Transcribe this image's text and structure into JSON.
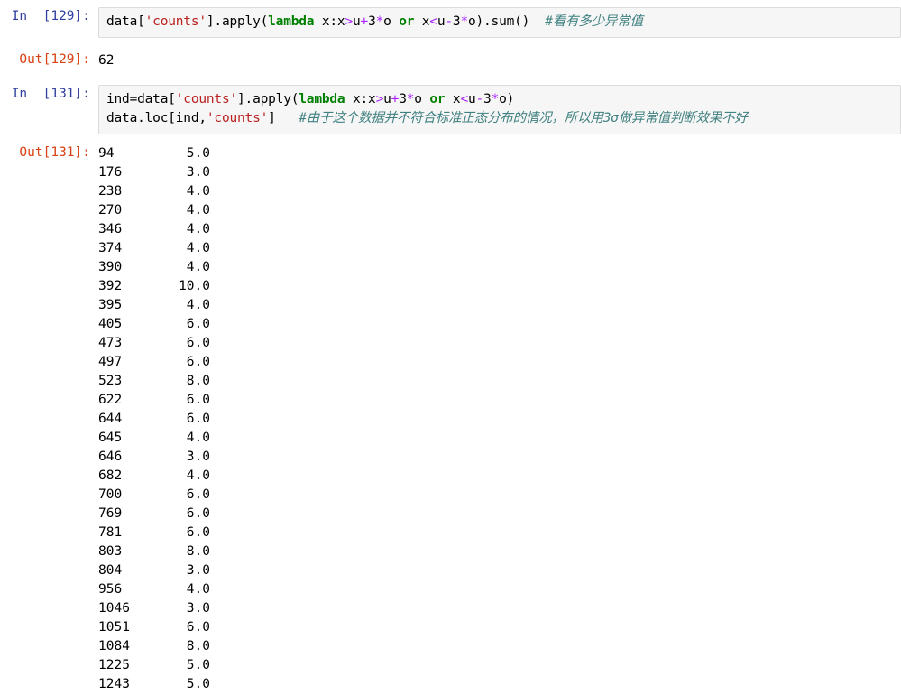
{
  "cells": [
    {
      "type": "input",
      "prompt": "In  [129]:",
      "lines": [
        [
          {
            "t": "plain",
            "v": "data["
          },
          {
            "t": "str",
            "v": "'counts'"
          },
          {
            "t": "plain",
            "v": "].apply("
          },
          {
            "t": "kw",
            "v": "lambda"
          },
          {
            "t": "plain",
            "v": " x:x"
          },
          {
            "t": "op",
            "v": ">"
          },
          {
            "t": "plain",
            "v": "u"
          },
          {
            "t": "op",
            "v": "+"
          },
          {
            "t": "plain",
            "v": "3"
          },
          {
            "t": "op",
            "v": "*"
          },
          {
            "t": "plain",
            "v": "o "
          },
          {
            "t": "kw",
            "v": "or"
          },
          {
            "t": "plain",
            "v": " x"
          },
          {
            "t": "op",
            "v": "<"
          },
          {
            "t": "plain",
            "v": "u"
          },
          {
            "t": "op",
            "v": "-"
          },
          {
            "t": "plain",
            "v": "3"
          },
          {
            "t": "op",
            "v": "*"
          },
          {
            "t": "plain",
            "v": "o).sum()  "
          },
          {
            "t": "com",
            "v": "#看有多少异常值"
          }
        ]
      ]
    },
    {
      "type": "output-scalar",
      "prompt": "Out[129]:",
      "value": "62"
    },
    {
      "type": "input",
      "prompt": "In  [131]:",
      "lines": [
        [
          {
            "t": "plain",
            "v": "ind=data["
          },
          {
            "t": "str",
            "v": "'counts'"
          },
          {
            "t": "plain",
            "v": "].apply("
          },
          {
            "t": "kw",
            "v": "lambda"
          },
          {
            "t": "plain",
            "v": " x:x"
          },
          {
            "t": "op",
            "v": ">"
          },
          {
            "t": "plain",
            "v": "u"
          },
          {
            "t": "op",
            "v": "+"
          },
          {
            "t": "plain",
            "v": "3"
          },
          {
            "t": "op",
            "v": "*"
          },
          {
            "t": "plain",
            "v": "o "
          },
          {
            "t": "kw",
            "v": "or"
          },
          {
            "t": "plain",
            "v": " x"
          },
          {
            "t": "op",
            "v": "<"
          },
          {
            "t": "plain",
            "v": "u"
          },
          {
            "t": "op",
            "v": "-"
          },
          {
            "t": "plain",
            "v": "3"
          },
          {
            "t": "op",
            "v": "*"
          },
          {
            "t": "plain",
            "v": "o)"
          }
        ],
        [
          {
            "t": "plain",
            "v": "data.loc[ind,"
          },
          {
            "t": "str",
            "v": "'counts'"
          },
          {
            "t": "plain",
            "v": "]   "
          },
          {
            "t": "com",
            "v": "#由于这个数据并不符合标准正态分布的情况，所以用3σ做异常值判断效果不好"
          }
        ]
      ]
    },
    {
      "type": "output-series",
      "prompt": "Out[131]:",
      "rows": [
        {
          "index": "94",
          "value": "5.0"
        },
        {
          "index": "176",
          "value": "3.0"
        },
        {
          "index": "238",
          "value": "4.0"
        },
        {
          "index": "270",
          "value": "4.0"
        },
        {
          "index": "346",
          "value": "4.0"
        },
        {
          "index": "374",
          "value": "4.0"
        },
        {
          "index": "390",
          "value": "4.0"
        },
        {
          "index": "392",
          "value": "10.0"
        },
        {
          "index": "395",
          "value": "4.0"
        },
        {
          "index": "405",
          "value": "6.0"
        },
        {
          "index": "473",
          "value": "6.0"
        },
        {
          "index": "497",
          "value": "6.0"
        },
        {
          "index": "523",
          "value": "8.0"
        },
        {
          "index": "622",
          "value": "6.0"
        },
        {
          "index": "644",
          "value": "6.0"
        },
        {
          "index": "645",
          "value": "4.0"
        },
        {
          "index": "646",
          "value": "3.0"
        },
        {
          "index": "682",
          "value": "4.0"
        },
        {
          "index": "700",
          "value": "6.0"
        },
        {
          "index": "769",
          "value": "6.0"
        },
        {
          "index": "781",
          "value": "6.0"
        },
        {
          "index": "803",
          "value": "8.0"
        },
        {
          "index": "804",
          "value": "3.0"
        },
        {
          "index": "956",
          "value": "4.0"
        },
        {
          "index": "1046",
          "value": "3.0"
        },
        {
          "index": "1051",
          "value": "6.0"
        },
        {
          "index": "1084",
          "value": "8.0"
        },
        {
          "index": "1225",
          "value": "5.0"
        },
        {
          "index": "1243",
          "value": "5.0"
        }
      ]
    }
  ],
  "colors": {
    "prompt_in": "#303f9f",
    "prompt_out": "#d84315",
    "string": "#bb2222",
    "keyword": "#008000",
    "operator": "#aa22ff",
    "comment": "#408080",
    "input_bg": "#f6f6f6",
    "input_border": "#dcdcdc",
    "page_bg": "#ffffff"
  }
}
